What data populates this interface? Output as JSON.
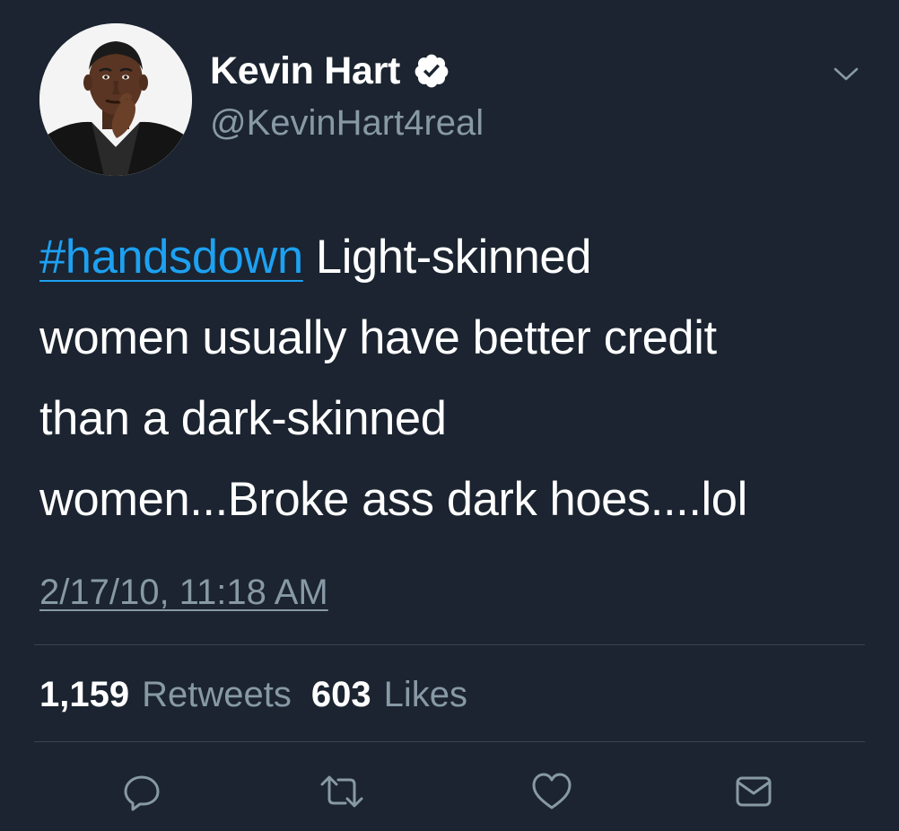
{
  "author": {
    "display_name": "Kevin Hart",
    "handle": "@KevinHart4real",
    "verified": true,
    "avatar_icon": "profile-photo"
  },
  "tweet": {
    "hashtag": "#handsdown",
    "text_lines": [
      " Light-skinned",
      "women usually have better credit",
      "than a dark-skinned",
      "women...Broke ass dark hoes....lol"
    ],
    "timestamp": "2/17/10, 11:18 AM"
  },
  "stats": {
    "retweets_count": "1,159",
    "retweets_label": "Retweets",
    "likes_count": "603",
    "likes_label": "Likes"
  },
  "icons": {
    "more": "chevron-down-icon",
    "verified": "verified-badge-icon",
    "reply": "reply-icon",
    "retweet": "retweet-icon",
    "like": "heart-icon",
    "message": "envelope-icon"
  },
  "colors": {
    "background": "#1b2430",
    "text": "#ffffff",
    "secondary_text": "#8899a6",
    "link": "#1da1f2",
    "divider": "#38444d"
  }
}
